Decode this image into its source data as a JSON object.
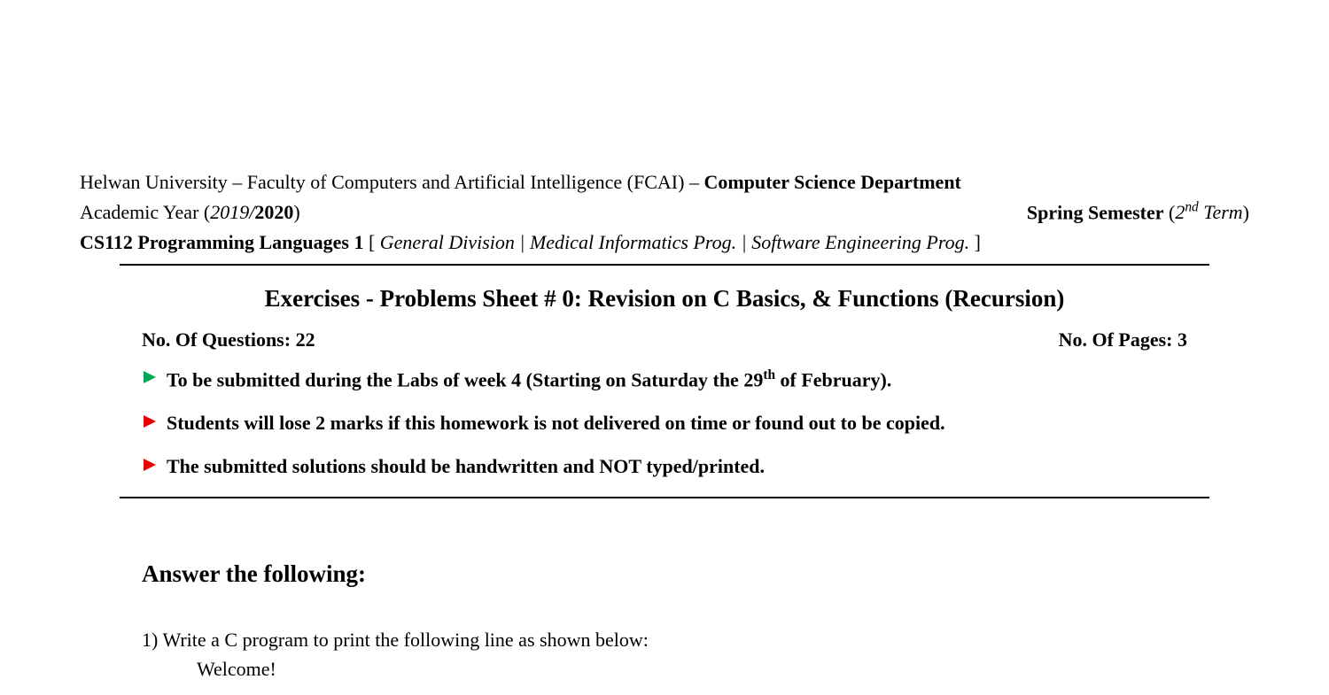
{
  "header": {
    "university": "Helwan University",
    "sep1": " – ",
    "faculty": "Faculty of Computers and Artificial Intelligence (FCAI)",
    "sep2": " – ",
    "department": "Computer Science Department",
    "academic_year_label": "Academic Year (",
    "academic_year_italic": "2019/",
    "academic_year_bold": "2020",
    "academic_year_close": ")",
    "semester_label": "Spring Semester",
    "semester_term_open": " (",
    "semester_term_italic_prefix": "2",
    "semester_term_sup": "nd",
    "semester_term_rest": " Term",
    "semester_term_close": ")",
    "course": "CS112 Programming Languages 1",
    "divisions_open": " [ ",
    "divisions": "General Division | Medical Informatics Prog. | Software Engineering Prog.",
    "divisions_close": " ]"
  },
  "sheet": {
    "title": "Exercises - Problems Sheet # 0: Revision on C Basics, & Functions (Recursion)",
    "questions_label": "No. Of Questions: ",
    "questions_count": "22",
    "pages_label": "No. Of Pages: ",
    "pages_count": "3"
  },
  "bullets": [
    {
      "color": "#00a651",
      "text_prefix": "To be submitted during the Labs of week 4 (Starting on Saturday the 29",
      "text_sup": "th",
      "text_suffix": " of February)."
    },
    {
      "color": "#e60000",
      "text_prefix": "Students will lose 2 marks if this homework is not delivered on time or found out to be copied.",
      "text_sup": "",
      "text_suffix": ""
    },
    {
      "color": "#e60000",
      "text_prefix": "The submitted solutions should be handwritten and NOT typed/printed.",
      "text_sup": "",
      "text_suffix": ""
    }
  ],
  "answer_heading": "Answer the following:",
  "question1": {
    "num": "1) ",
    "text": "Write a C program to print the following line as shown below:",
    "line1": "Welcome!"
  }
}
